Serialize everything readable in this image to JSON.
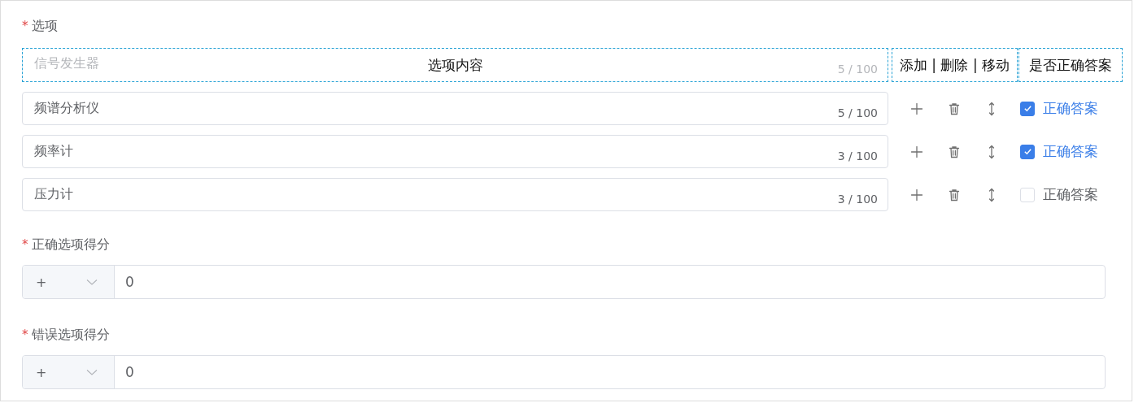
{
  "options_section": {
    "required_mark": "*",
    "label": "选项",
    "header": {
      "faded_option": "信号发生器",
      "faded_count": "5 / 100",
      "columns": [
        "选项内容",
        "添加 | 删除 | 移动",
        "是否正确答案"
      ]
    },
    "options": [
      {
        "value": "频谱分析仪",
        "count": "5 / 100",
        "correct": true,
        "answer_label": "正确答案"
      },
      {
        "value": "频率计",
        "count": "3 / 100",
        "correct": true,
        "answer_label": "正确答案"
      },
      {
        "value": "压力计",
        "count": "3 / 100",
        "correct": false,
        "answer_label": "正确答案"
      }
    ]
  },
  "score_fields": [
    {
      "required_mark": "*",
      "label": "正确选项得分",
      "sign": "+",
      "value": "0"
    },
    {
      "required_mark": "*",
      "label": "错误选项得分",
      "sign": "+",
      "value": "0"
    }
  ]
}
